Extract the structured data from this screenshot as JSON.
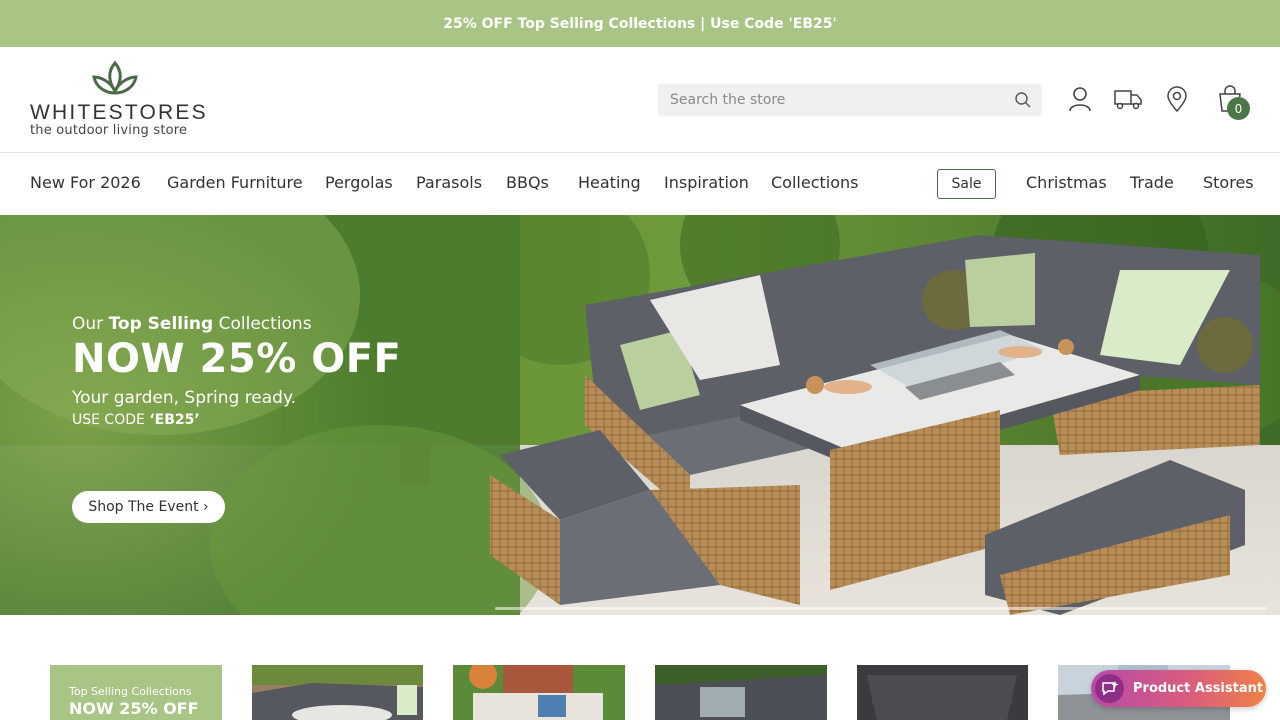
{
  "promo": {
    "text": "25% OFF Top Selling Collections | Use Code 'EB25'"
  },
  "brand": {
    "name": "WHITESTORES",
    "tagline": "the outdoor living store"
  },
  "search": {
    "placeholder": "Search the store"
  },
  "cart": {
    "count": "0"
  },
  "nav": {
    "items": [
      "New For 2026",
      "Garden Furniture",
      "Pergolas",
      "Parasols",
      "BBQs",
      "Heating",
      "Inspiration",
      "Collections"
    ],
    "sale": "Sale",
    "right_items": [
      "Christmas",
      "Trade",
      "Stores"
    ]
  },
  "hero": {
    "eyebrow_pre": "Our ",
    "eyebrow_bold": "Top Selling",
    "eyebrow_post": " Collections",
    "headline": "NOW 25% OFF",
    "subline": "Your garden, Spring ready.",
    "code_pre": "USE CODE ",
    "code_bold": "‘EB25’",
    "cta": "Shop The Event ›"
  },
  "promo_card": {
    "line1": "Top Selling Collections",
    "line2": "NOW 25% OFF"
  },
  "assistant": {
    "label": "Product Assistant"
  },
  "colors": {
    "brand_green": "#a9c586",
    "dark_green": "#4a7747",
    "assistant_start": "#b64ba9",
    "assistant_end": "#f08146"
  }
}
